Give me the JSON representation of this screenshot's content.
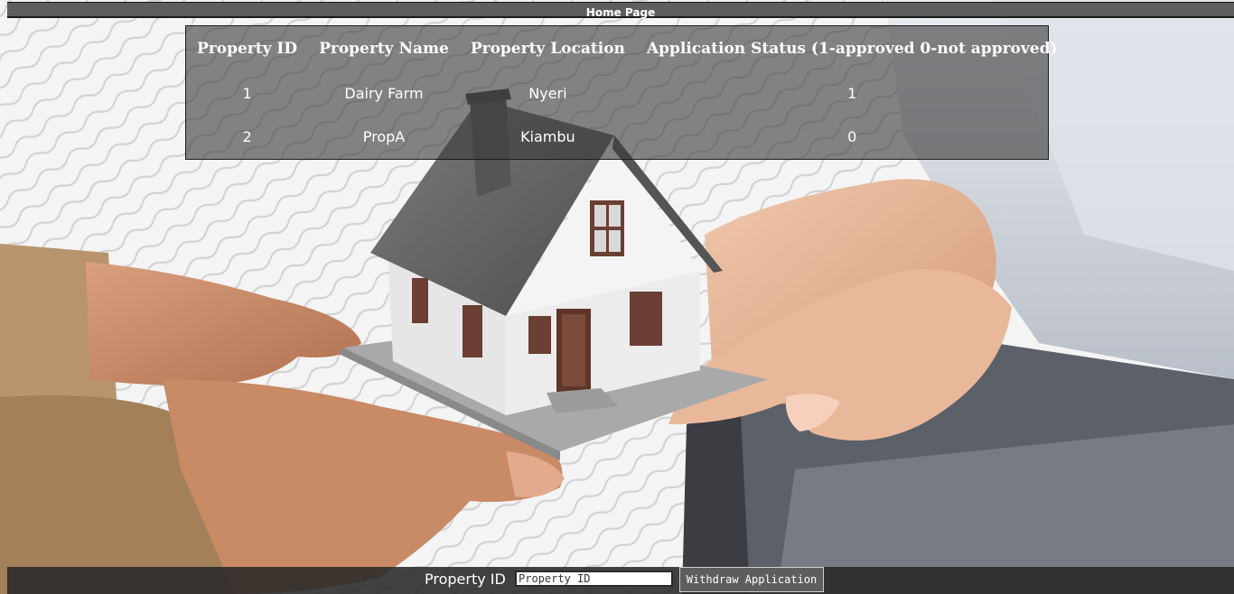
{
  "nav": {
    "home_label": "Home Page"
  },
  "table": {
    "headers": [
      "Property ID",
      "Property Name",
      "Property Location",
      "Application Status (1-approved 0-not approved)"
    ],
    "rows": [
      [
        "1",
        "Dairy Farm",
        "Nyeri",
        "1"
      ],
      [
        "2",
        "PropA",
        "Kiambu",
        "0"
      ]
    ]
  },
  "form": {
    "property_id_label": "Property ID",
    "property_id_placeholder": "Property ID",
    "withdraw_label": "Withdraw Application"
  },
  "background": {
    "image_subject": "hands passing a model house"
  }
}
